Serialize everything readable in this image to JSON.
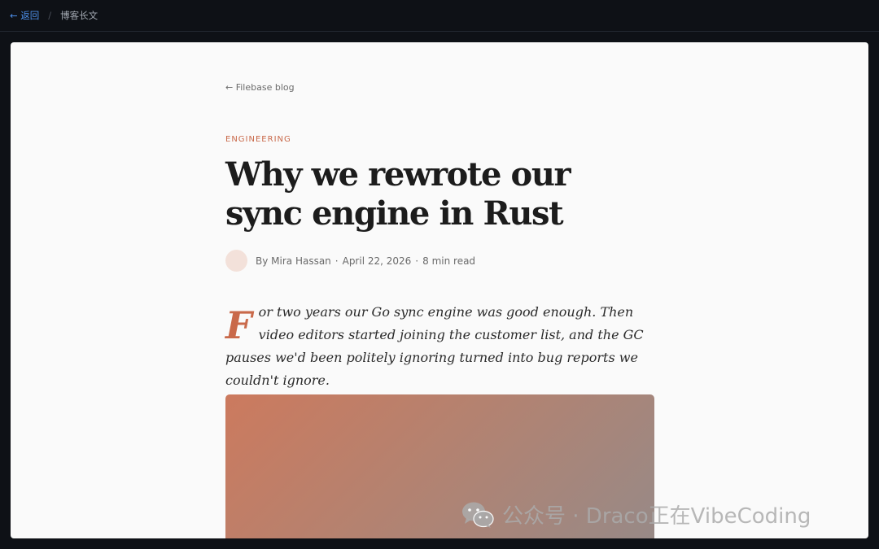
{
  "topbar": {
    "back_label": "← 返回",
    "separator": "/",
    "current_page": "博客长文"
  },
  "article": {
    "blog_back_label": "← Filebase blog",
    "category": "ENGINEERING",
    "title": "Why we rewrote our sync engine in Rust",
    "byline": {
      "author": "By Mira Hassan",
      "date": "April 22, 2026",
      "read_time": "8 min read",
      "separator": "·"
    },
    "lede_dropcap": "F",
    "lede_text": "or two years our Go sync engine was good enough. Then video editors started joining the customer list, and the GC pauses we'd been politely ignoring turned into bug reports we couldn't ignore."
  },
  "watermark": {
    "icon": "wechat-icon",
    "text": "公众号 · Draco正在VibeCoding"
  },
  "colors": {
    "accent": "#c9694a",
    "link": "#4d8fea",
    "background": "#0e1116",
    "paper": "#fafafa"
  }
}
